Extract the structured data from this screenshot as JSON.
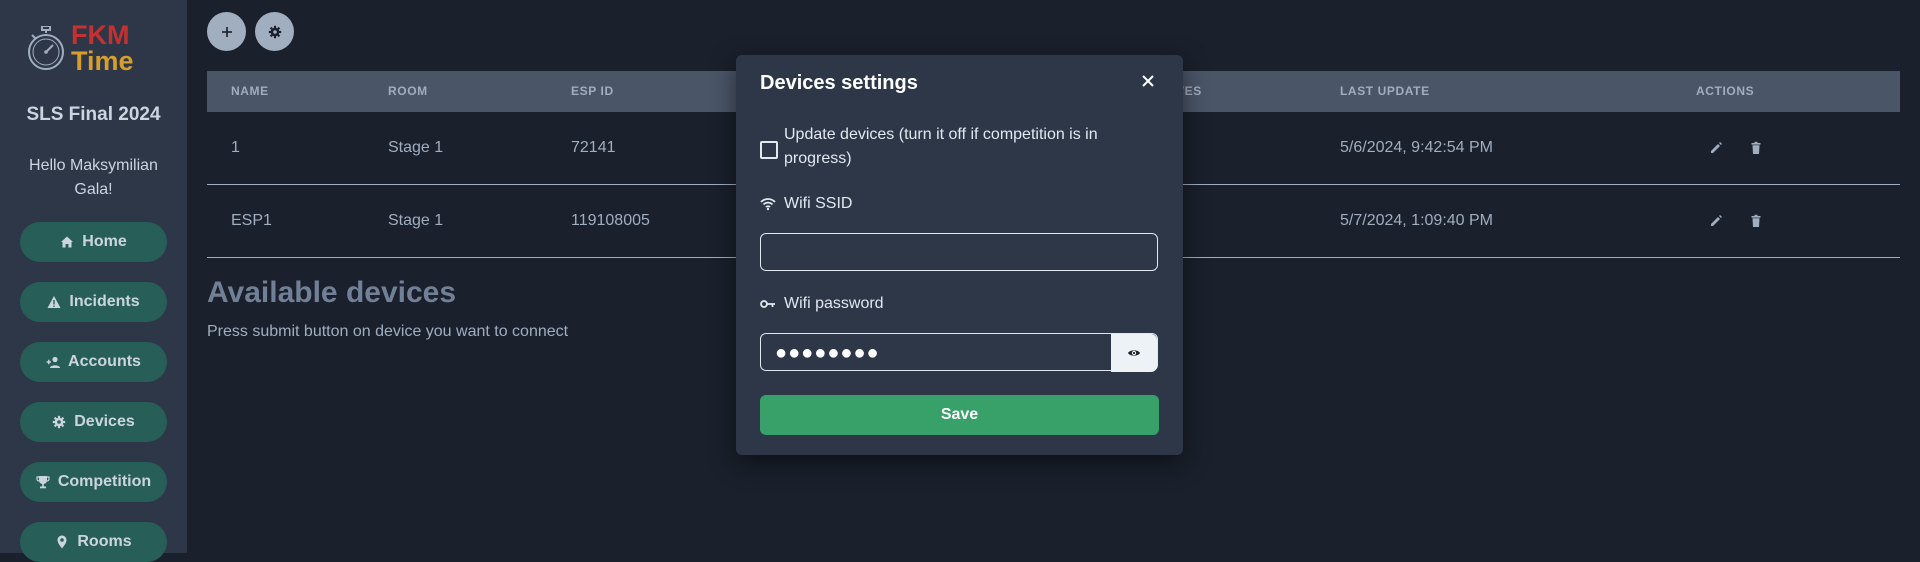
{
  "sidebar": {
    "logo": {
      "line1": "FKM",
      "line2": "Time"
    },
    "event_name": "SLS Final 2024",
    "greeting": "Hello Maksymilian Gala!",
    "nav": [
      {
        "label": "Home",
        "icon": "home-icon"
      },
      {
        "label": "Incidents",
        "icon": "warning-icon"
      },
      {
        "label": "Accounts",
        "icon": "add-user-icon"
      },
      {
        "label": "Devices",
        "icon": "gear-icon"
      },
      {
        "label": "Competition",
        "icon": "trophy-icon"
      },
      {
        "label": "Rooms",
        "icon": "pin-icon"
      }
    ]
  },
  "toolbar": {
    "add_icon": "plus-icon",
    "settings_icon": "gear-icon"
  },
  "table": {
    "columns": [
      "NAME",
      "ROOM",
      "ESP ID",
      "LVES",
      "LAST UPDATE",
      "ACTIONS"
    ],
    "rows": [
      {
        "name": "1",
        "room": "Stage 1",
        "esp_id": "72141",
        "last_update": "5/6/2024, 9:42:54 PM"
      },
      {
        "name": "ESP1",
        "room": "Stage 1",
        "esp_id": "119108005",
        "last_update": "5/7/2024, 1:09:40 PM"
      }
    ]
  },
  "available": {
    "title": "Available devices",
    "subtitle": "Press submit button on device you want to connect"
  },
  "modal": {
    "title": "Devices settings",
    "update_checkbox_label": "Update devices (turn it off if competition is in progress)",
    "update_checked": false,
    "wifi_ssid_label": "Wifi SSID",
    "wifi_ssid_value": "",
    "wifi_password_label": "Wifi password",
    "wifi_password_masked": "●●●●●●●●",
    "save_label": "Save"
  },
  "colors": {
    "background": "#1a202c",
    "sidebar": "#2d3748",
    "nav_button": "#285e58",
    "save_button": "#38a169",
    "logo_red": "#c53030",
    "logo_gold": "#d69e2e"
  }
}
